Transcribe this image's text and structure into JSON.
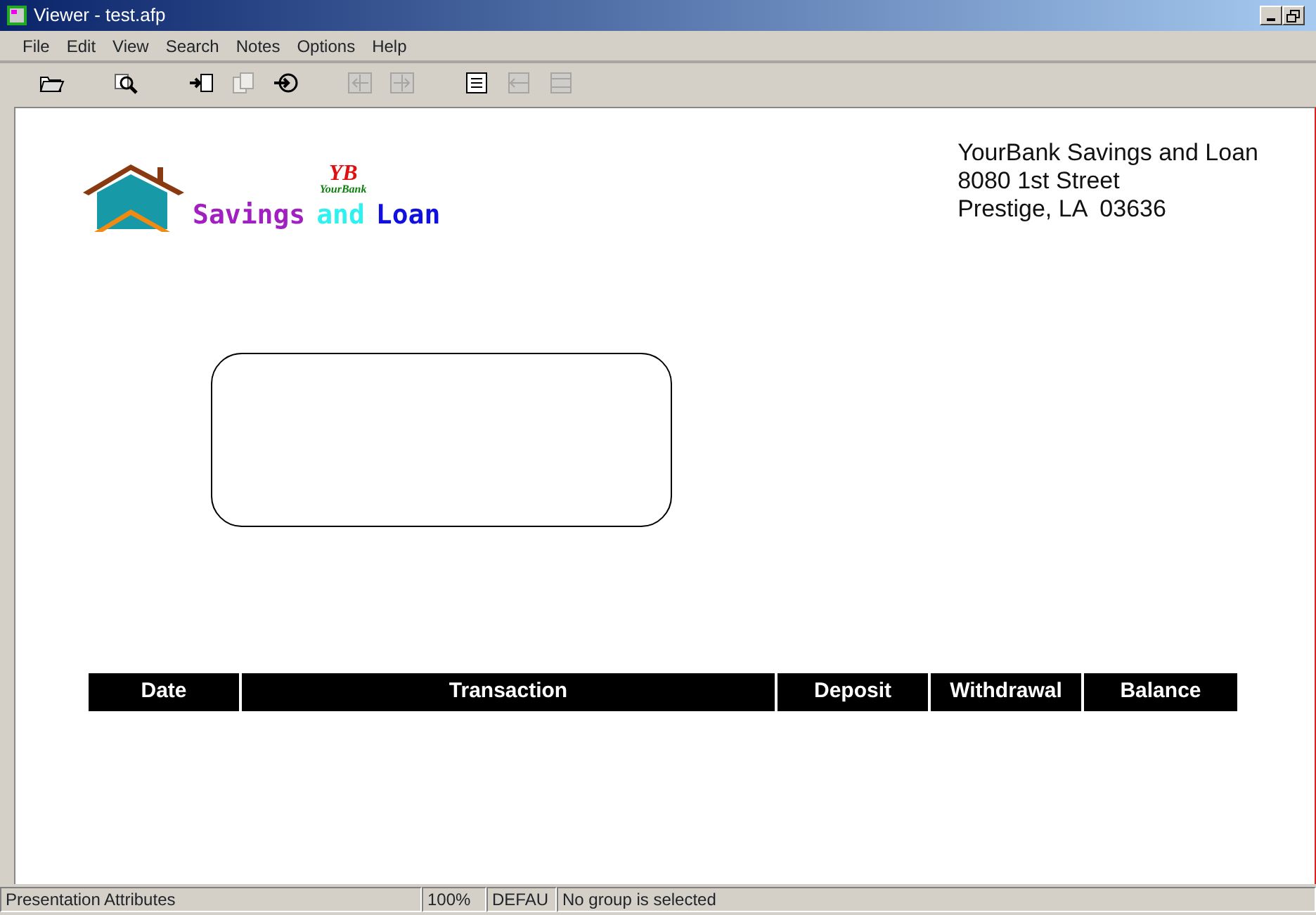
{
  "window": {
    "title": "Viewer - test.afp"
  },
  "menu": [
    "File",
    "Edit",
    "View",
    "Search",
    "Notes",
    "Options",
    "Help"
  ],
  "toolbar": [
    [
      {
        "kind": "open",
        "disabled": false
      }
    ],
    [
      {
        "kind": "find",
        "disabled": false
      }
    ],
    [
      {
        "kind": "import",
        "disabled": false
      },
      {
        "kind": "pages",
        "disabled": true
      },
      {
        "kind": "goto",
        "disabled": false
      }
    ],
    [
      {
        "kind": "prev",
        "disabled": true
      },
      {
        "kind": "next",
        "disabled": true
      }
    ],
    [
      {
        "kind": "list",
        "disabled": false
      },
      {
        "kind": "collapse",
        "disabled": true
      },
      {
        "kind": "expand",
        "disabled": true
      }
    ]
  ],
  "document": {
    "logo": {
      "initials": "YB",
      "brand": "YourBank",
      "words": [
        {
          "text": "Savings",
          "color": "#a020c0"
        },
        {
          "text": "and",
          "color": "#30f0f0"
        },
        {
          "text": "Loan",
          "color": "#1010e0"
        }
      ]
    },
    "address": [
      "YourBank Savings and Loan",
      "8080 1st Street",
      "Prestige, LA  03636"
    ],
    "table": {
      "columns": [
        "Date",
        "Transaction",
        "Deposit",
        "Withdrawal",
        "Balance"
      ]
    }
  },
  "status_bar": [
    "Presentation Attributes",
    "100%",
    "DEFAU",
    "No group is selected"
  ]
}
